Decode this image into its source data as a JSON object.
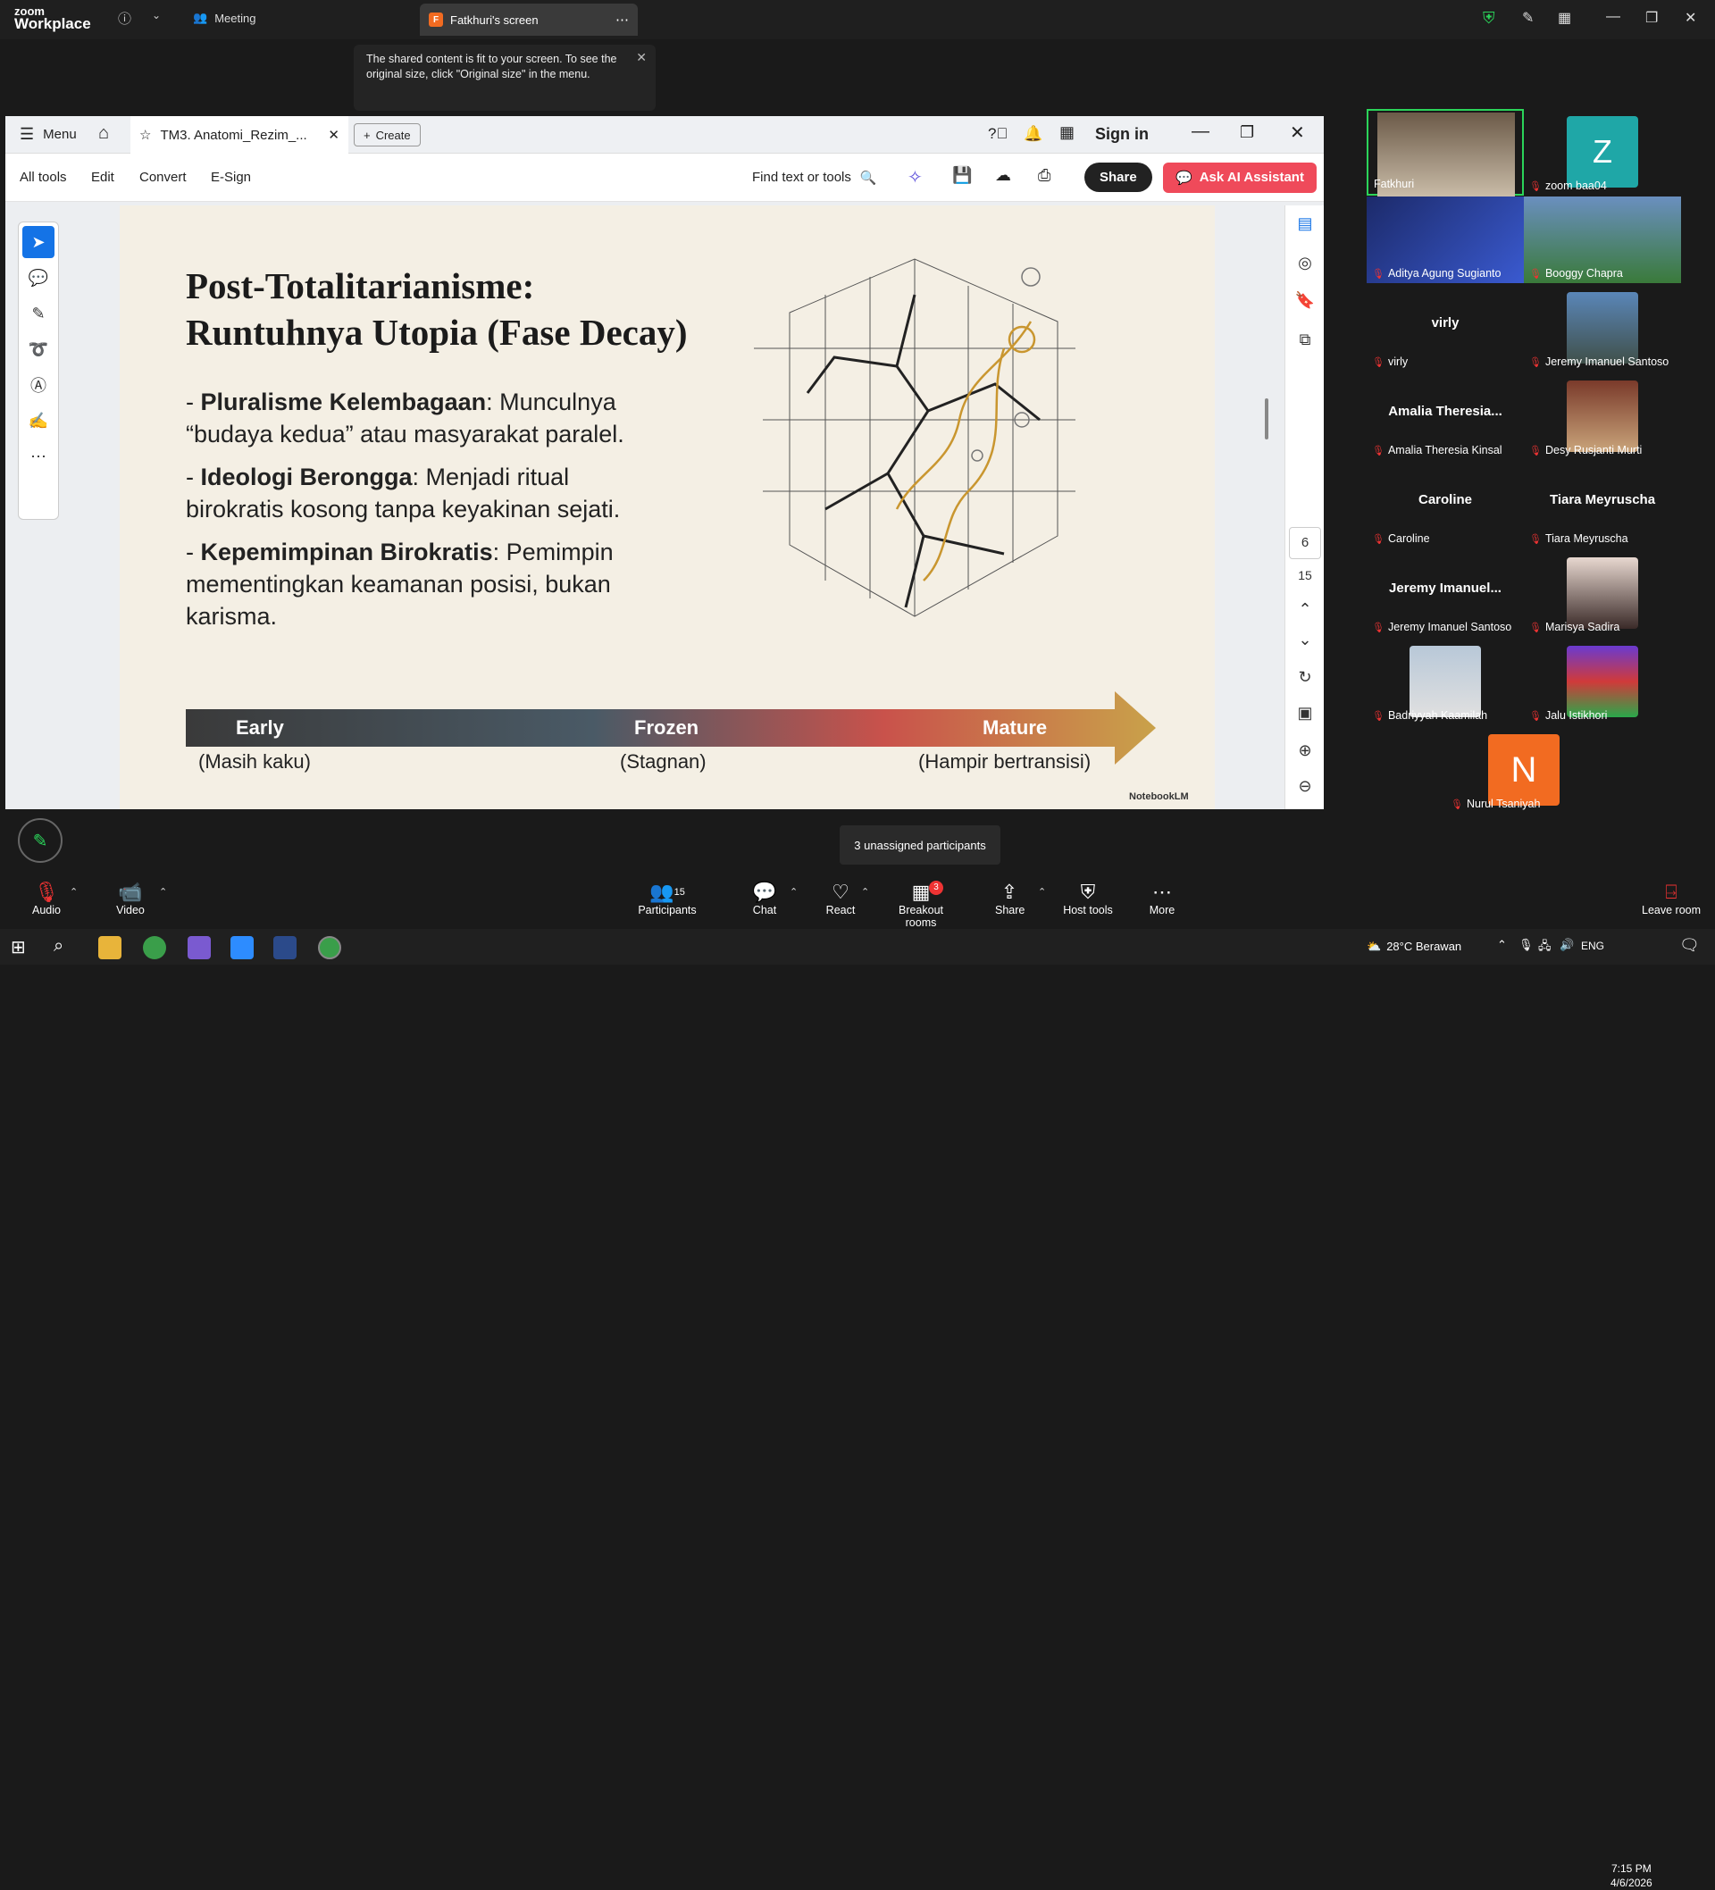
{
  "zoom": {
    "logo_top": "zoom",
    "logo_bottom": "Workplace",
    "meeting_tab": "Meeting",
    "screen_tab": "Fatkhuri's screen",
    "screen_tab_badge": "F",
    "tooltip": "The shared content is fit to your screen. To see the original size, click \"Original size\" in the menu.",
    "unassigned_popup": "3 unassigned participants"
  },
  "acrobat": {
    "menu": "Menu",
    "doc_tab": "TM3. Anatomi_Rezim_...",
    "create": "Create",
    "sign_in": "Sign in",
    "tools": [
      "All tools",
      "Edit",
      "Convert",
      "E-Sign"
    ],
    "find": "Find text or tools",
    "share": "Share",
    "ai": "Ask AI Assistant",
    "page_current": "6",
    "page_total": "15"
  },
  "slide": {
    "title_line1": "Post-Totalitarianisme:",
    "title_line2": "Runtuhnya Utopia (Fase Decay)",
    "b1_bold": "Pluralisme Kelembagaan",
    "b1_rest": ": Munculnya",
    "b1_line2": "“budaya kedua” atau masyarakat paralel.",
    "b2_bold": "Ideologi Berongga",
    "b2_rest": ": Menjadi ritual",
    "b2_line2": "birokratis kosong tanpa keyakinan sejati.",
    "b3_bold": "Kepemimpinan Birokratis",
    "b3_rest": ": Pemimpin",
    "b3_line2": "mementingkan keamanan posisi, bukan",
    "b3_line3": "karisma.",
    "timeline": {
      "early": "Early",
      "frozen": "Frozen",
      "mature": "Mature",
      "early_sub": "(Masih kaku)",
      "frozen_sub": "(Stagnan)",
      "mature_sub": "(Hampir bertransisi)"
    },
    "watermark": "NotebookLM"
  },
  "participants": [
    {
      "name": "Fatkhuri",
      "display": "",
      "video": true
    },
    {
      "name": "zoom baa04",
      "display": "Z",
      "video": false
    },
    {
      "name": "Aditya Agung Sugianto",
      "display": "",
      "video": true
    },
    {
      "name": "Booggy Chapra",
      "display": "",
      "video": true
    },
    {
      "name": "virly",
      "display": "virly",
      "video": false
    },
    {
      "name": "Jeremy Imanuel Santoso",
      "display": "",
      "video": true
    },
    {
      "name": "Amalia Theresia Kinsal",
      "display": "Amalia Theresia...",
      "video": false
    },
    {
      "name": "Desy Rusjanti Murti",
      "display": "",
      "video": true
    },
    {
      "name": "Caroline",
      "display": "Caroline",
      "video": false
    },
    {
      "name": "Tiara Meyruscha",
      "display": "Tiara Meyruscha",
      "video": false
    },
    {
      "name": "Jeremy Imanuel Santoso",
      "display": "Jeremy Imanuel...",
      "video": false
    },
    {
      "name": "Marisya Sadira",
      "display": "",
      "video": true
    },
    {
      "name": "Badriyyah Kaamilah",
      "display": "",
      "video": true
    },
    {
      "name": "Jalu Istikhori",
      "display": "",
      "video": true
    },
    {
      "name": "Nurul Tsaniyah",
      "display": "N",
      "video": false
    }
  ],
  "bottombar": {
    "audio": "Audio",
    "video": "Video",
    "participants": "Participants",
    "participants_count": "15",
    "chat": "Chat",
    "react": "React",
    "breakout": "Breakout rooms",
    "breakout_badge": "3",
    "share": "Share",
    "host_tools": "Host tools",
    "more": "More",
    "leave": "Leave room"
  },
  "taskbar": {
    "weather": "28°C  Berawan",
    "lang": "ENG",
    "time": "7:15 PM",
    "date": "4/6/2026"
  }
}
